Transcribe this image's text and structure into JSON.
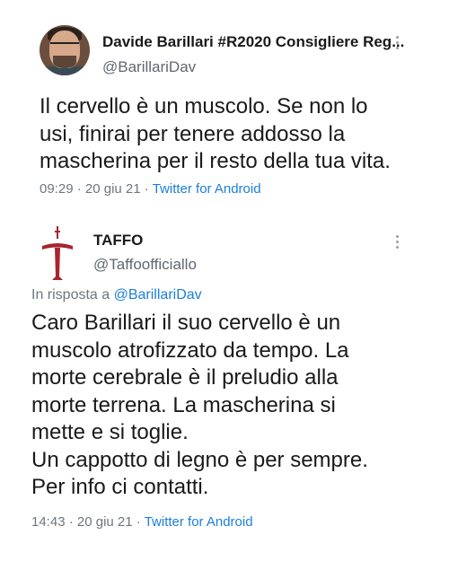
{
  "tweet1": {
    "display_name": "Davide Barillari #R2020 Consigliere Reg...",
    "handle": "@BarillariDav",
    "lines": [
      "Il cervello è un muscolo. Se non lo",
      "usi, finirai per tenere addosso la",
      "mascherina per il resto della tua vita."
    ],
    "time": "09:29",
    "date": "20 giu 21",
    "source": "Twitter for Android",
    "avatar_icon": "profile-photo"
  },
  "tweet2": {
    "display_name": "TAFFO",
    "handle": "@Taffoofficiallo",
    "reply_prefix": "In risposta a ",
    "reply_mention": "@BarillariDav",
    "lines": [
      "Caro Barillari il suo cervello è un",
      "muscolo atrofizzato da tempo. La",
      "morte cerebrale è il preludio alla",
      "morte terrena.  La mascherina si",
      "mette e si toglie.",
      "Un cappotto di legno è per sempre.",
      "Per info ci contatti."
    ],
    "time": "14:43",
    "date": "20 giu 21",
    "source": "Twitter for Android",
    "avatar_icon": "taffo-cross-logo"
  },
  "separator": " · ",
  "colors": {
    "link": "#1b7fd8",
    "muted": "#6e767d",
    "logo_red": "#a6242f"
  }
}
